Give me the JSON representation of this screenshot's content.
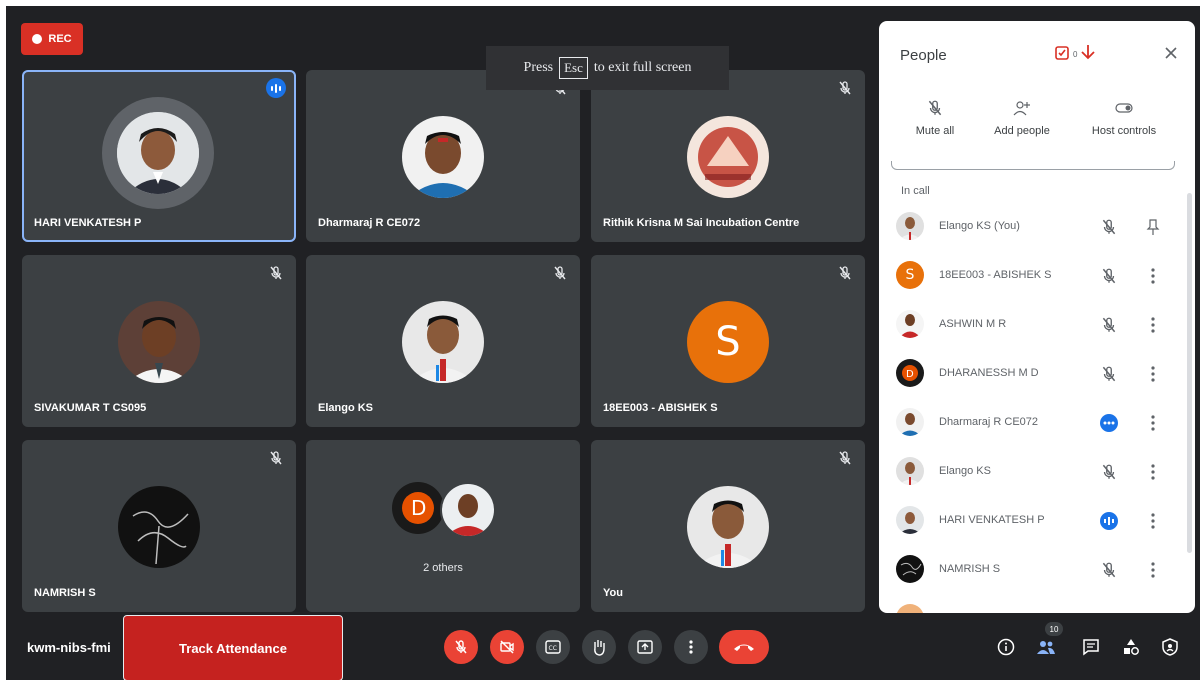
{
  "recording": {
    "label": "REC"
  },
  "fullscreen_toast": {
    "before": "Press",
    "key": "Esc",
    "after": "to exit full screen"
  },
  "tiles": [
    {
      "name": "HARI VENKATESH P",
      "state": "speaking"
    },
    {
      "name": "Dharmaraj R CE072",
      "state": "muted"
    },
    {
      "name": "Rithik Krisna M Sai Incubation Centre",
      "state": "muted"
    },
    {
      "name": "SIVAKUMAR T CS095",
      "state": "muted"
    },
    {
      "name": "Elango KS",
      "state": "muted"
    },
    {
      "name": "18EE003 - ABISHEK S",
      "state": "muted",
      "initial": "S"
    },
    {
      "name": "NAMRISH S",
      "state": "muted"
    },
    {
      "name": "2 others",
      "state": "group"
    },
    {
      "name": "You",
      "state": "muted"
    }
  ],
  "people_panel": {
    "title": "People",
    "badge_count": "0",
    "actions": [
      "Mute all",
      "Add people",
      "Host controls"
    ],
    "section_label": "In call",
    "participants": [
      {
        "name": "Elango KS (You)",
        "status": "muted",
        "action": "pin"
      },
      {
        "name": "18EE003 - ABISHEK S",
        "status": "muted",
        "initial": "S"
      },
      {
        "name": "ASHWIN M R",
        "status": "muted"
      },
      {
        "name": "DHARANESSH M D",
        "status": "muted"
      },
      {
        "name": "Dharmaraj R CE072",
        "status": "more"
      },
      {
        "name": "Elango KS",
        "status": "muted"
      },
      {
        "name": "HARI VENKATESH P",
        "status": "speaking"
      },
      {
        "name": "NAMRISH S",
        "status": "muted"
      }
    ]
  },
  "bottom_bar": {
    "meeting_code": "kwm-nibs-fmi",
    "track_attendance": "Track Attendance",
    "participants_count": "10"
  },
  "colors": {
    "background": "#202124",
    "tile": "#3c4043",
    "accent_blue": "#1a73e8",
    "danger_red": "#ea4335",
    "orange_avatar": "#e8710a"
  }
}
